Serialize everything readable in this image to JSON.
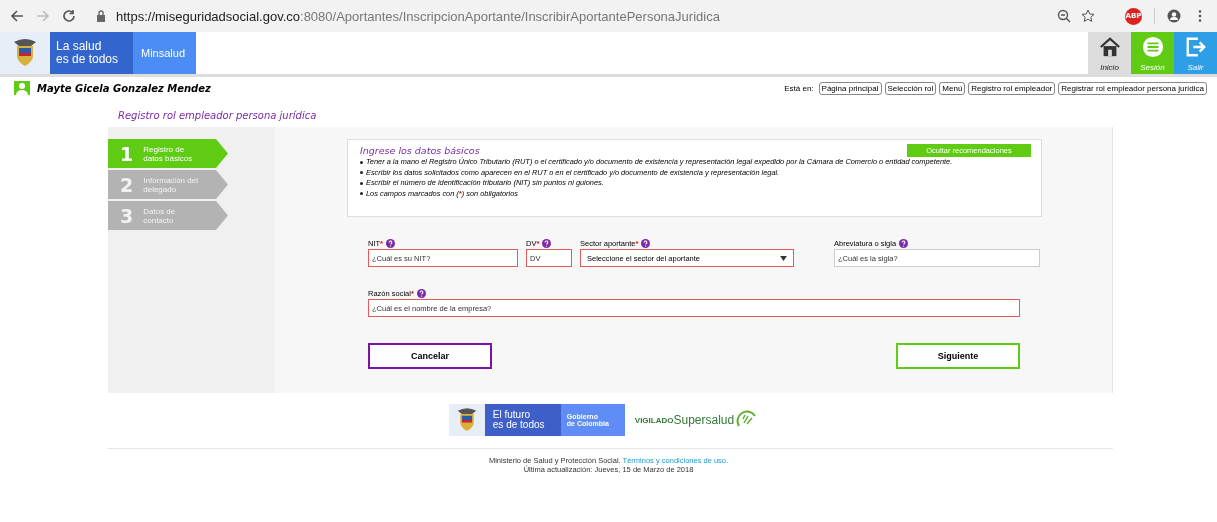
{
  "browser": {
    "url_host": "https://miseguridadsocial.gov.co",
    "url_rest": ":8080/Aportantes/InscripcionAportante/InscribirAportantePersonaJuridica",
    "adblock_badge": "ABP"
  },
  "header": {
    "brand_line1": "La salud",
    "brand_line2": "es de todos",
    "ministry": "Minsalud",
    "nav": [
      {
        "label": "Inicio",
        "kind": "home"
      },
      {
        "label": "Sesión",
        "kind": "session"
      },
      {
        "label": "Salir",
        "kind": "exit"
      }
    ]
  },
  "user_bar": {
    "name": "Mayte Gicela Gonzalez Mendez",
    "breadcrumb_label": "Está en:",
    "breadcrumb": [
      "Página principal",
      "Selección rol",
      "Menú",
      "Registro rol empleador",
      "Registrar rol empleador persona jurídica"
    ]
  },
  "page_title": "Registro rol empleador persona jurídica",
  "steps": [
    {
      "number": "1",
      "label": "Registro de datos básicos",
      "selected": true
    },
    {
      "number": "2",
      "label": "Información del delegado",
      "selected": false
    },
    {
      "number": "3",
      "label": "Datos de contacto",
      "selected": false
    }
  ],
  "recommendations": {
    "title": "Ingrese los datos básicos",
    "hide_button": "Ocultar recomendaciones",
    "items": [
      "Tener a la mano el Registro Único Tributario (RUT) o el certificado y/o documento de existencia y representación legal expedido por la Cámara de Comercio o entidad competente.",
      "Escribir los datos solicitados como aparecen en el RUT o en el certificado y/o documento de existencia y representación legal.",
      "Escribir el número de identificación tributario (NIT) sin puntos ni guiones."
    ],
    "required_note": {
      "before": "Los campos marcados con (",
      "mark": "*",
      "after": ") son obligatorios"
    }
  },
  "fields": [
    {
      "label": "NIT",
      "required": true,
      "kind": "text",
      "placeholder": "¿Cuál es su NIT?"
    },
    {
      "label": "DV",
      "required": true,
      "kind": "text",
      "placeholder": "DV"
    },
    {
      "label": "Sector aportante",
      "required": true,
      "kind": "select",
      "value": "Seleccione el sector del aportante"
    },
    {
      "label": "Abreviatura o sigla",
      "required": false,
      "kind": "text",
      "placeholder": "¿Cuál es la sigla?"
    },
    {
      "label": "Razón social",
      "required": true,
      "kind": "text",
      "placeholder": "¿Cuál es el nombre de la empresa?"
    }
  ],
  "buttons": [
    {
      "label": "Cancelar",
      "kind": "secondary"
    },
    {
      "label": "Siguiente",
      "kind": "primary"
    }
  ],
  "footer": {
    "logo_line1": "El futuro",
    "logo_line2": "es de todos",
    "gov_line1": "Gobierno",
    "gov_line2": "de Colombia",
    "vigilado": "VIGILADO",
    "supersalud": "Supersalud",
    "ministry_text": "Ministerio de Salud y Protección Social.",
    "terms_link": "Términos y condiciones de uso.",
    "updated": "Última actualización: Jueves, 15 de Marzo de 2018"
  }
}
